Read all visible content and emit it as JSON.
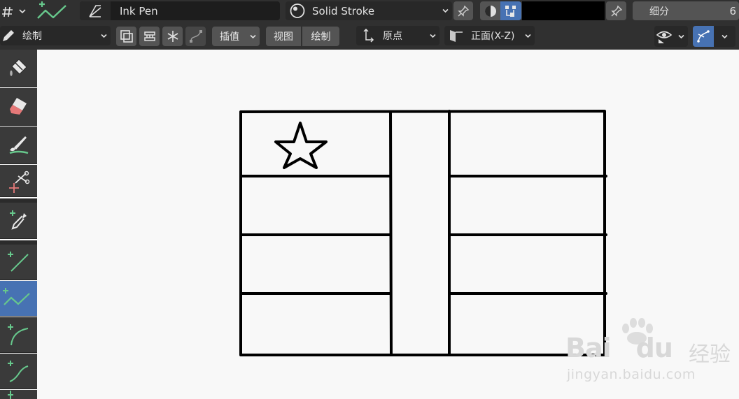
{
  "header": {
    "brush_name": "Ink Pen",
    "material_name": "Solid Stroke",
    "color_swatch": "#000000",
    "subdivide_label": "细分",
    "subdivide_value": "6"
  },
  "tool_settings": {
    "mode_label": "绘制",
    "interpolate_label": "插值",
    "view_button": "视图",
    "draw_button": "绘制",
    "origin_label": "原点",
    "plane_label": "正面(X-Z)"
  },
  "toolbar": {
    "tools": [
      "fill",
      "erase",
      "tint",
      "cutter",
      "eyedropper",
      "line",
      "polyline",
      "arc",
      "curve"
    ],
    "active": "polyline"
  },
  "colors": {
    "accent": "#4772b3",
    "stroke_green": "#67c88c",
    "stroke_black": "#000000",
    "header_bg": "#303030",
    "canvas_bg": "#f8f8f8"
  },
  "watermark": {
    "brand_a": "Bai",
    "brand_b": "du",
    "brand_cn": "经验",
    "url": "jingyan.baidu.com"
  }
}
